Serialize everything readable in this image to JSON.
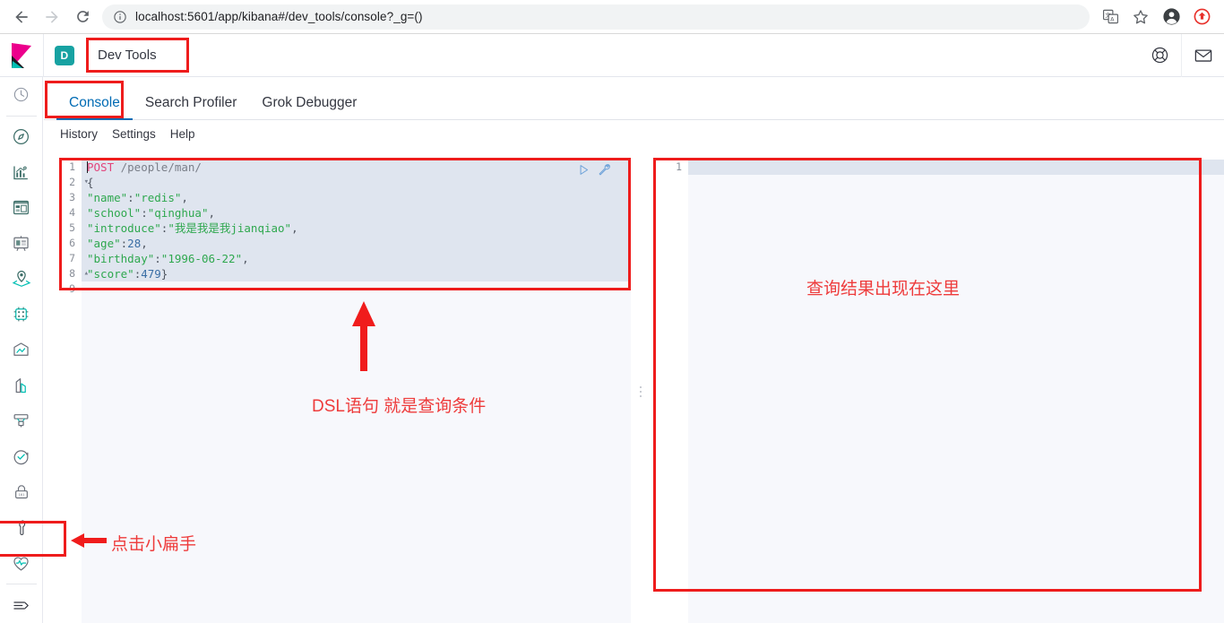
{
  "browser": {
    "back_icon": "arrow-left-icon",
    "forward_icon": "arrow-right-icon",
    "reload_icon": "reload-icon",
    "info_icon": "page-info-icon",
    "url_host": "localhost:5601",
    "url_path": "/app/kibana#/dev_tools/console?_g=()",
    "url_full": "localhost:5601/app/kibana#/dev_tools/console?_g=()",
    "actions": [
      {
        "name": "translate-icon",
        "label": "Translate"
      },
      {
        "name": "bookmark-star-icon",
        "label": "Bookmark"
      },
      {
        "name": "profile-avatar-icon",
        "label": "Profile"
      },
      {
        "name": "extension-icon",
        "label": "Extension"
      }
    ]
  },
  "kibana_header": {
    "logo": "kibana-logo",
    "space_badge": "D",
    "breadcrumb": "Dev Tools",
    "right_icons": [
      {
        "name": "help-lifebuoy-icon",
        "label": "Help"
      },
      {
        "name": "mail-envelope-icon",
        "label": "News feed"
      }
    ]
  },
  "sidebar": {
    "items": [
      {
        "name": "recently-viewed-icon",
        "label": "Recently viewed"
      },
      {
        "name": "discover-compass-icon",
        "label": "Discover"
      },
      {
        "name": "visualize-chart-icon",
        "label": "Visualize"
      },
      {
        "name": "dashboard-icon",
        "label": "Dashboard"
      },
      {
        "name": "canvas-icon",
        "label": "Canvas"
      },
      {
        "name": "maps-icon",
        "label": "Maps"
      },
      {
        "name": "machine-learning-icon",
        "label": "Machine Learning"
      },
      {
        "name": "infrastructure-icon",
        "label": "Infrastructure"
      },
      {
        "name": "logs-icon",
        "label": "Logs"
      },
      {
        "name": "apm-icon",
        "label": "APM"
      },
      {
        "name": "uptime-icon",
        "label": "Uptime"
      },
      {
        "name": "siem-lock-icon",
        "label": "SIEM"
      },
      {
        "name": "dev-tools-wrench-icon",
        "label": "Dev Tools"
      },
      {
        "name": "monitoring-heart-icon",
        "label": "Monitoring"
      },
      {
        "name": "collapse-nav-icon",
        "label": "Collapse"
      }
    ]
  },
  "tabs": [
    {
      "label": "Console",
      "active": true
    },
    {
      "label": "Search Profiler",
      "active": false
    },
    {
      "label": "Grok Debugger",
      "active": false
    }
  ],
  "submenu": [
    {
      "label": "History"
    },
    {
      "label": "Settings"
    },
    {
      "label": "Help"
    }
  ],
  "request_editor": {
    "actions": [
      {
        "name": "play-send-request-icon",
        "label": "Click to send request"
      },
      {
        "name": "wrench-settings-icon",
        "label": "Open documentation"
      }
    ],
    "lines": [
      {
        "n": "1",
        "fold": "",
        "text": "POST /people/man/"
      },
      {
        "n": "2",
        "fold": "▾",
        "text": "{"
      },
      {
        "n": "3",
        "fold": "",
        "text": "\"name\":\"redis\","
      },
      {
        "n": "4",
        "fold": "",
        "text": "\"school\":\"qinghua\","
      },
      {
        "n": "5",
        "fold": "",
        "text": "\"introduce\":\"我是我是我jianqiao\","
      },
      {
        "n": "6",
        "fold": "",
        "text": "\"age\":28,"
      },
      {
        "n": "7",
        "fold": "",
        "text": "\"birthday\":\"1996-06-22\","
      },
      {
        "n": "8",
        "fold": "▴",
        "text": "\"score\":479}"
      },
      {
        "n": "9",
        "fold": "",
        "text": ""
      }
    ]
  },
  "response_editor": {
    "lines": [
      {
        "n": "1",
        "text": ""
      }
    ]
  },
  "annotations": [
    {
      "name": "annotation-click-wrench",
      "text": "点击小扁手"
    },
    {
      "name": "annotation-dsl-query",
      "text": "DSL语句 就是查询条件"
    },
    {
      "name": "annotation-results-here",
      "text": "查询结果出现在这里"
    }
  ],
  "annotation_text": {
    "click_wrench": "点击小扁手",
    "dsl_query": "DSL语句 就是查询条件",
    "results_here": "查询结果出现在这里"
  },
  "colors": {
    "accent_blue": "#006bb4",
    "annotation_red": "#ee1c1c",
    "annotation_text_red": "#ee3b3b",
    "badge_teal": "#17a2a2",
    "editor_highlight": "#dfe5ef",
    "string_green": "#2fa84f",
    "method_pink": "#e2467c"
  }
}
